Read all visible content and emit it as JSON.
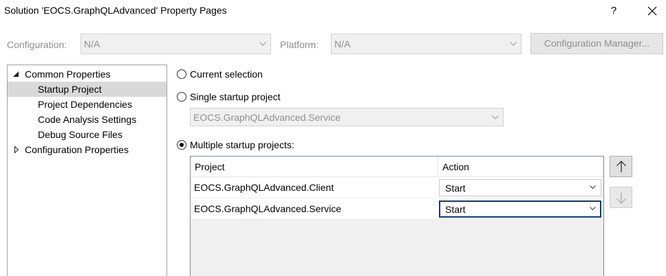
{
  "window": {
    "title": "Solution 'EOCS.GraphQLAdvanced' Property Pages",
    "help_label": "?"
  },
  "toolbar": {
    "configuration_label": "Configuration:",
    "configuration_value": "N/A",
    "platform_label": "Platform:",
    "platform_value": "N/A",
    "config_manager_label": "Configuration Manager..."
  },
  "tree": {
    "items": [
      {
        "label": "Common Properties",
        "expanded": true
      },
      {
        "label": "Startup Project",
        "selected": true
      },
      {
        "label": "Project Dependencies"
      },
      {
        "label": "Code Analysis Settings"
      },
      {
        "label": "Debug Source Files"
      },
      {
        "label": "Configuration Properties",
        "expanded": false
      }
    ]
  },
  "startup": {
    "current_selection_label": "Current selection",
    "single_label": "Single startup project",
    "single_value": "EOCS.GraphQLAdvanced.Service",
    "multiple_label": "Multiple startup projects:",
    "selected_option": "multiple"
  },
  "grid": {
    "headers": {
      "project": "Project",
      "action": "Action"
    },
    "rows": [
      {
        "project": "EOCS.GraphQLAdvanced.Client",
        "action": "Start"
      },
      {
        "project": "EOCS.GraphQLAdvanced.Service",
        "action": "Start"
      }
    ]
  },
  "icons": {
    "close": "close-icon",
    "dropdown": "chevron-down-icon",
    "tree_expanded": "triangle-expanded-icon",
    "tree_collapsed": "triangle-collapsed-icon",
    "move_up": "arrow-up-icon",
    "move_down": "arrow-down-icon"
  }
}
